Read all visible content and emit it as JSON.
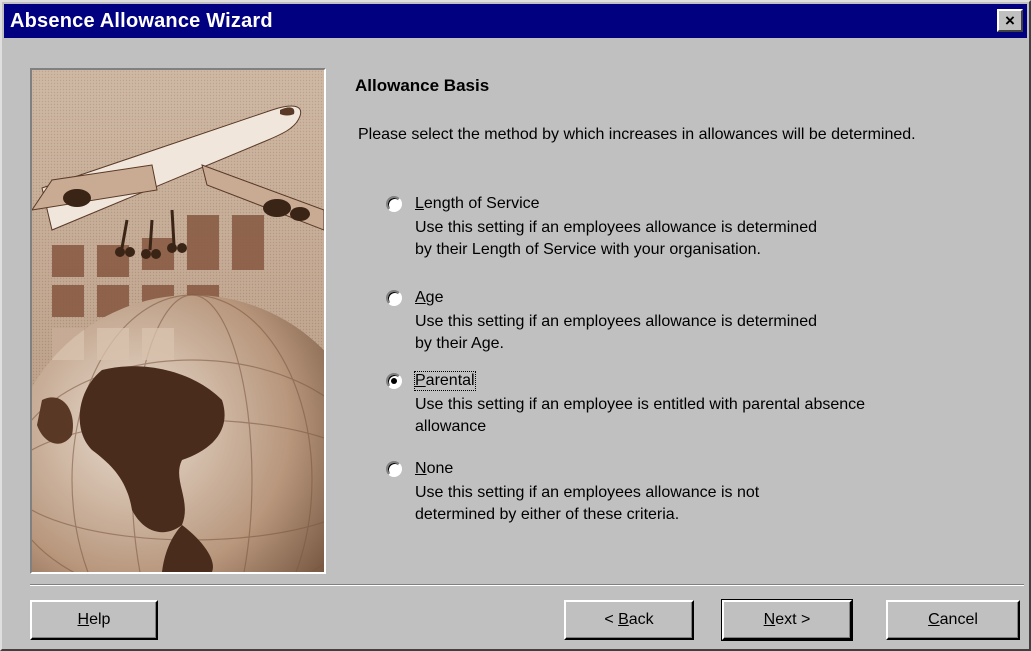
{
  "window": {
    "title": "Absence Allowance Wizard",
    "close_label": "×"
  },
  "content": {
    "title": "Allowance Basis",
    "intro": "Please select the method by which increases in allowances will be determined."
  },
  "options": [
    {
      "label": "Length of Service",
      "mnemonic": "L",
      "rest": "ength of Service",
      "description_1": "Use this setting if an employees allowance is determined",
      "description_2": "by their Length of Service with your organisation.",
      "selected": false
    },
    {
      "label": "Age",
      "mnemonic": "A",
      "rest": "ge",
      "description_1": "Use this setting if an employees allowance is determined",
      "description_2": "by their Age.",
      "selected": false
    },
    {
      "label": "Parental",
      "mnemonic": "P",
      "rest": "arental",
      "description_1": "Use this setting if an employee is entitled with parental absence",
      "description_2": "allowance",
      "selected": true
    },
    {
      "label": "None",
      "mnemonic": "N",
      "rest": "one",
      "description_1": "Use this setting if an employees allowance is not",
      "description_2": "determined by either of these criteria.",
      "selected": false
    }
  ],
  "buttons": {
    "help": {
      "mnemonic": "H",
      "rest": "elp"
    },
    "back": {
      "prefix": "< ",
      "mnemonic": "B",
      "rest": "ack"
    },
    "next": {
      "mnemonic": "N",
      "rest": "ext >"
    },
    "cancel": {
      "mnemonic": "C",
      "rest": "ancel"
    }
  },
  "colors": {
    "titlebar": "#000080",
    "face": "#c0c0c0",
    "banner_tone": "#b79a83"
  }
}
